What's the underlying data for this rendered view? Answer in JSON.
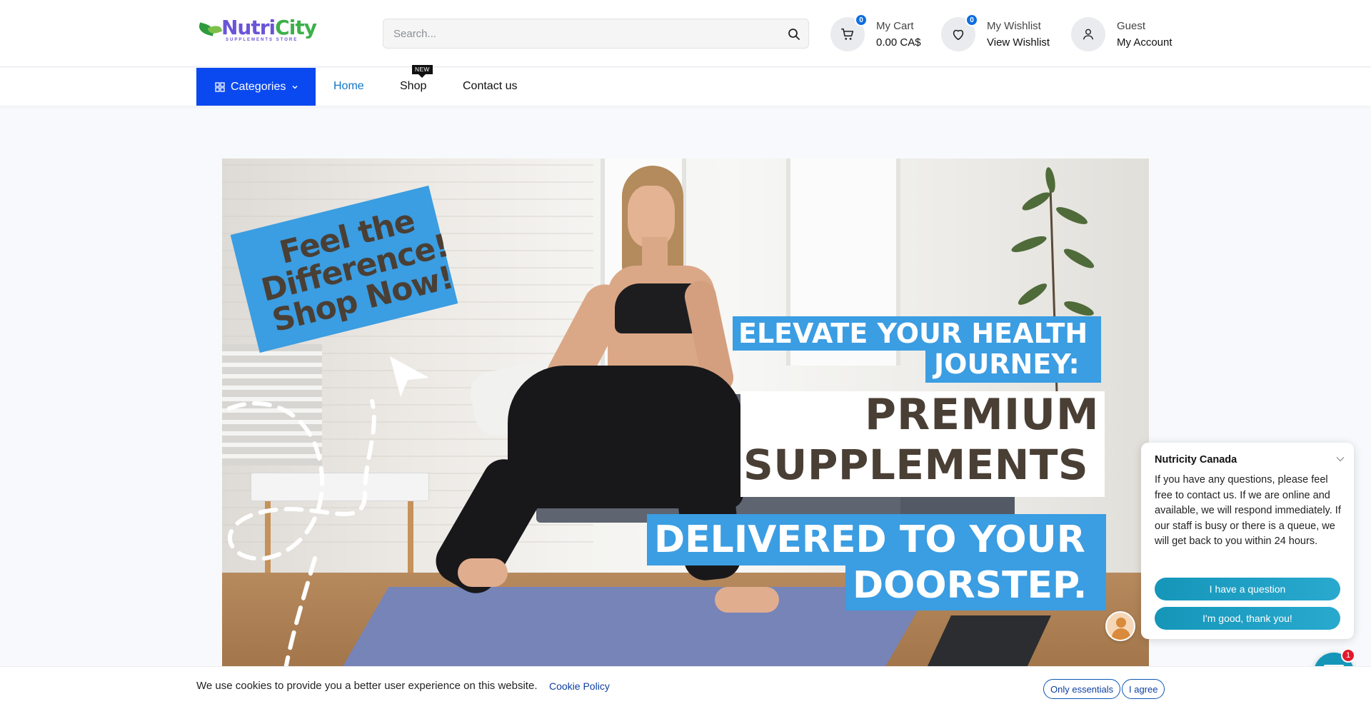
{
  "header": {
    "logo": {
      "brand_part1": "Nutri",
      "brand_part2": "City",
      "tagline": "SUPPLEMENTS STORE"
    },
    "search": {
      "placeholder": "Search...",
      "value": ""
    },
    "cart": {
      "badge": "0",
      "label": "My Cart",
      "value": "0.00 CA$"
    },
    "wishlist": {
      "badge": "0",
      "label": "My Wishlist",
      "value": "View Wishlist"
    },
    "account": {
      "label": "Guest",
      "value": "My Account"
    }
  },
  "nav": {
    "categories_label": "Categories",
    "links": [
      {
        "label": "Home",
        "active": true
      },
      {
        "label": "Shop",
        "tag": "NEW"
      },
      {
        "label": "Contact us"
      }
    ]
  },
  "hero": {
    "promo_lines": [
      "Feel the",
      "Difference!",
      "Shop Now!"
    ],
    "headline_line1": "ELEVATE YOUR HEALTH",
    "headline_line2": "JOURNEY:",
    "premium_line1": "PREMIUM",
    "premium_line2": "SUPPLEMENTS",
    "delivered_line1": "DELIVERED TO YOUR",
    "delivered_line2": "DOORSTEP."
  },
  "chat": {
    "title": "Nutricity Canada",
    "message": "If you have any questions, please feel free to contact us. If we are online and available, we will respond immediately. If our staff is busy or there is a queue, we will get back to you within 24 hours.",
    "btn_question": "I have a question",
    "btn_good": "I'm good, thank you!",
    "unread_count": "1"
  },
  "cookie": {
    "text": "We use cookies to provide you a better user experience on this website.",
    "link": "Cookie Policy",
    "btn_essentials": "Only essentials",
    "btn_agree": "I agree"
  },
  "colors": {
    "accent_blue": "#0a49f0",
    "link_blue": "#1176c8",
    "badge_blue": "#0d6ee0",
    "hero_label_blue": "#3b9de2",
    "hero_text_brown": "#4a3f35",
    "chat_teal": "#1596b9",
    "logo_purple": "#6a55d8",
    "logo_green": "#3bb14a"
  },
  "icons": {
    "search": "search-icon",
    "cart": "cart-icon",
    "wishlist": "heart-icon",
    "account": "user-icon",
    "categories": "grid-icon",
    "chat": "chat-bubble-icon"
  }
}
